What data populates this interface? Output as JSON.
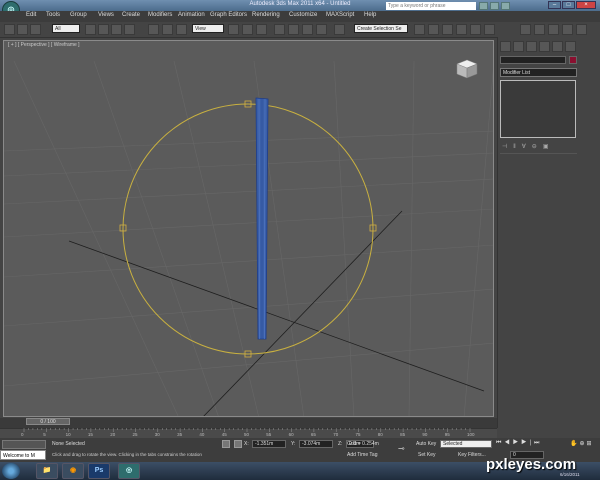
{
  "window": {
    "title": "Autodesk 3ds Max 2011 x64 - Untitled",
    "logo": "3ds-max-logo"
  },
  "search": {
    "placeholder": "Type a keyword or phrase"
  },
  "menu": [
    "Edit",
    "Tools",
    "Group",
    "Views",
    "Create",
    "Modifiers",
    "Animation",
    "Graph Editors",
    "Rendering",
    "Customize",
    "MAXScript",
    "Help"
  ],
  "toolbar": {
    "selection_filter": "All",
    "ref_coord": "View",
    "named_selection": "Create Selection Se"
  },
  "viewport": {
    "label": "[ + ] [ Perspective ] [ Wireframe ]",
    "viewcube_icon": "viewcube-icon"
  },
  "command_panel": {
    "modifier_list": "Modifier List"
  },
  "timeline": {
    "slider_label": "0 / 100",
    "ticks": [
      "0",
      "5",
      "10",
      "15",
      "20",
      "25",
      "30",
      "35",
      "40",
      "45",
      "50",
      "55",
      "60",
      "65",
      "70",
      "75",
      "80",
      "85",
      "90",
      "95",
      "100"
    ]
  },
  "status": {
    "selection": "None Selected",
    "prompt": "Click and drag to rotate the view.  Clicking in the tabs constrains the rotation",
    "x": "-1.351m",
    "y": "-3.074m",
    "z": "0.0m",
    "grid": "Grid = 0.254m",
    "add_time_tag": "Add Time Tag",
    "auto_key": "Auto Key",
    "set_key": "Set Key",
    "selected": "Selected",
    "key_filters": "Key Filters...",
    "frame": "0",
    "maxscript": "Welcome to M"
  },
  "taskbar": {
    "apps": [
      {
        "name": "explorer",
        "label": "📁"
      },
      {
        "name": "firefox",
        "label": "◉"
      },
      {
        "name": "photoshop",
        "label": "Ps"
      },
      {
        "name": "3dsmax",
        "label": "◎"
      }
    ],
    "date": "6/16/2011"
  },
  "watermark": "pxleyes.com"
}
